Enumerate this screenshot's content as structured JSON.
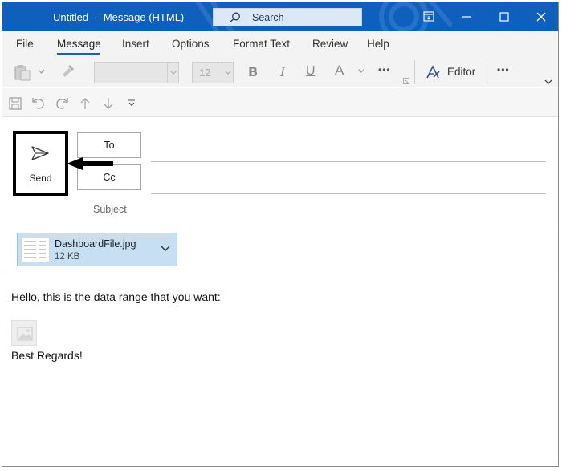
{
  "window": {
    "title": "Untitled  -  Message (HTML)",
    "search_placeholder": "Search"
  },
  "tabs": [
    "File",
    "Message",
    "Insert",
    "Options",
    "Format Text",
    "Review",
    "Help"
  ],
  "active_tab": "Message",
  "ribbon": {
    "font_name": "",
    "font_size": "12",
    "bold_label": "B",
    "italic_label": "I",
    "underline_label": "U",
    "font_color_label": "A",
    "more_label": "•••",
    "editor_label": "Editor",
    "overflow_label": "•••"
  },
  "header": {
    "send_label": "Send",
    "to_label": "To",
    "cc_label": "Cc",
    "subject_label": "Subject"
  },
  "attachment": {
    "name": "DashboardFile.jpg",
    "size": "12 KB"
  },
  "body": {
    "line1": "Hello, this is the data range that you want:",
    "line2": "Best Regards!"
  },
  "colors": {
    "titlebar": "#0f5fbd",
    "accent": "#1e5fa8",
    "attachment_bg": "#c6dff3"
  }
}
